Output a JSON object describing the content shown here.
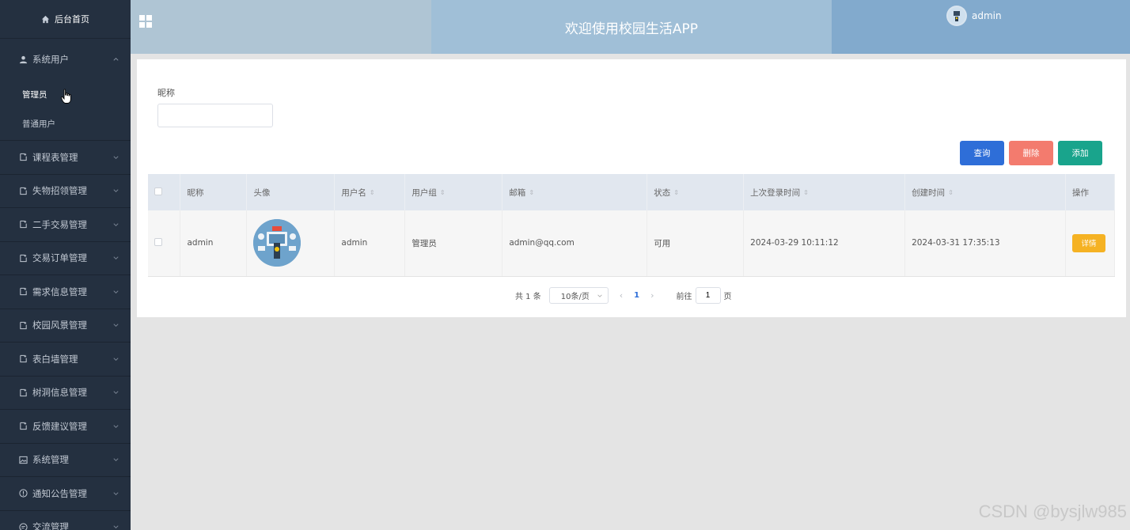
{
  "sidebar": {
    "home_label": "后台首页",
    "open_menu": {
      "label": "系统用户",
      "icon": "user-icon",
      "sub_items": [
        "管理员",
        "普通用户"
      ]
    },
    "items": [
      {
        "label": "课程表管理",
        "icon": "doc-icon"
      },
      {
        "label": "失物招领管理",
        "icon": "doc-icon"
      },
      {
        "label": "二手交易管理",
        "icon": "doc-icon"
      },
      {
        "label": "交易订单管理",
        "icon": "doc-icon"
      },
      {
        "label": "需求信息管理",
        "icon": "doc-icon"
      },
      {
        "label": "校园风景管理",
        "icon": "doc-icon"
      },
      {
        "label": "表白墙管理",
        "icon": "doc-icon"
      },
      {
        "label": "树洞信息管理",
        "icon": "doc-icon"
      },
      {
        "label": "反馈建议管理",
        "icon": "doc-icon"
      },
      {
        "label": "系统管理",
        "icon": "image-icon"
      },
      {
        "label": "通知公告管理",
        "icon": "info-icon"
      },
      {
        "label": "交流管理",
        "icon": "chat-icon"
      }
    ]
  },
  "header": {
    "title": "欢迎使用校园生活APP",
    "user": "admin",
    "colors": {
      "left": "#afc5d4",
      "mid": "#a0bfd7",
      "right": "#82aacd"
    }
  },
  "search": {
    "label": "昵称",
    "value": "",
    "placeholder": ""
  },
  "actions": {
    "query": "查询",
    "delete": "删除",
    "add": "添加"
  },
  "table": {
    "columns": [
      "昵称",
      "头像",
      "用户名",
      "用户组",
      "邮箱",
      "状态",
      "上次登录时间",
      "创建时间",
      "操作"
    ],
    "rows": [
      {
        "nickname": "admin",
        "username": "admin",
        "group": "管理员",
        "email": "admin@qq.com",
        "status": "可用",
        "last_login": "2024-03-29 10:11:12",
        "created": "2024-03-31 17:35:13",
        "action": "详情"
      }
    ]
  },
  "pagination": {
    "total": "共 1 条",
    "page_size": "10条/页",
    "current": "1",
    "goto_prefix": "前往",
    "goto_value": "1",
    "goto_suffix": "页"
  },
  "watermark": "CSDN @bysjlw985"
}
